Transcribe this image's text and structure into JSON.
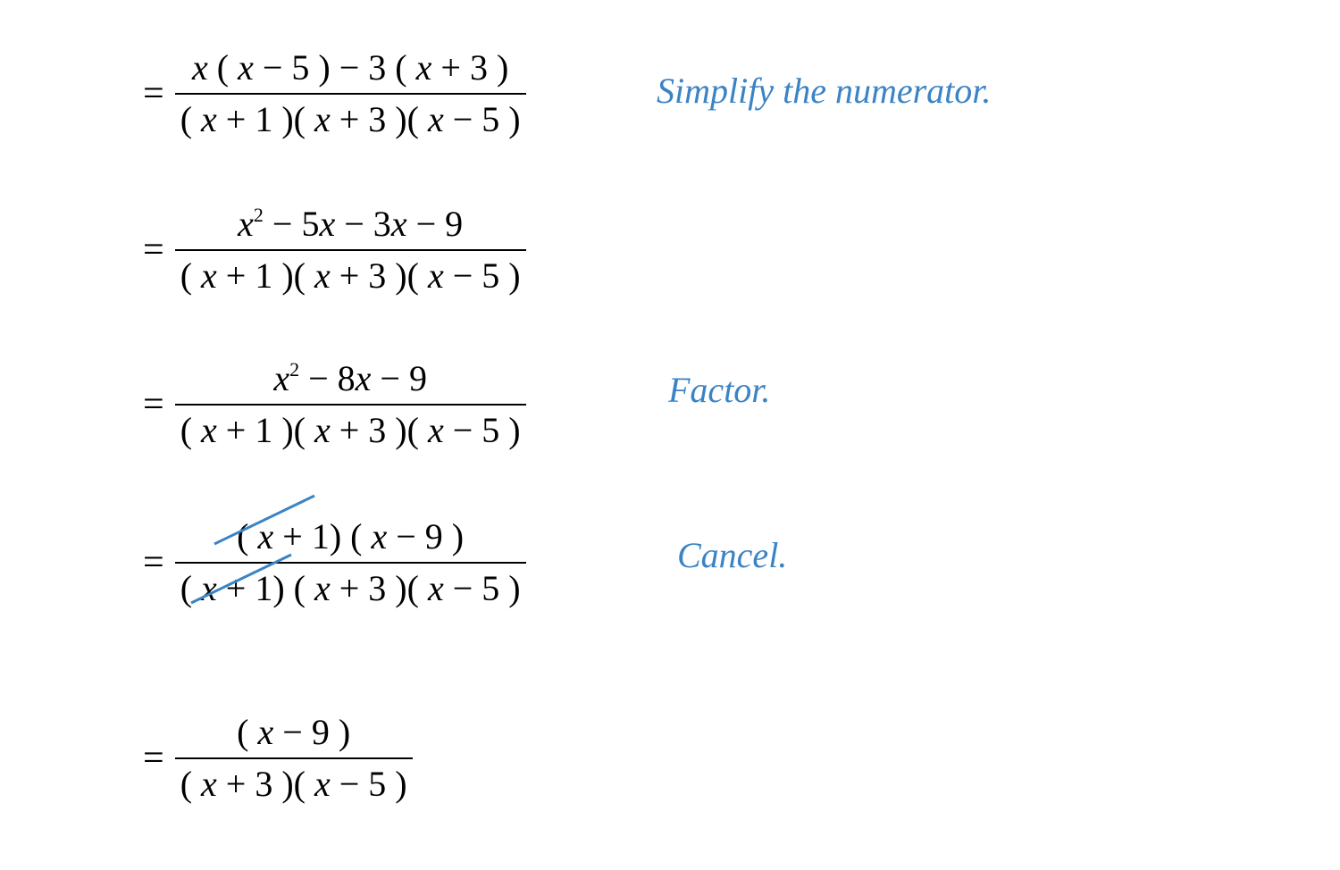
{
  "annotations": {
    "step1": "Simplify the numerator.",
    "step3": "Factor.",
    "step4": "Cancel."
  },
  "steps": {
    "s1": {
      "numerator": "x ( x − 5 ) − 3 ( x + 3 )",
      "denominator": "( x + 1 )( x + 3 )( x − 5 )"
    },
    "s2": {
      "numerator": "x² − 5x − 3x − 9",
      "denominator": "( x + 1 )( x + 3 )( x − 5 )"
    },
    "s3": {
      "numerator": "x² − 8x − 9",
      "denominator": "( x + 1 )( x + 3 )( x − 5 )"
    },
    "s4": {
      "numerator": "( x + 1 ) ( x − 9 )",
      "denominator": "( x + 1 ) ( x + 3 )( x − 5 )"
    },
    "s5": {
      "numerator": "( x − 9 )",
      "denominator": "( x + 3 )( x − 5 )"
    }
  },
  "equals": "="
}
